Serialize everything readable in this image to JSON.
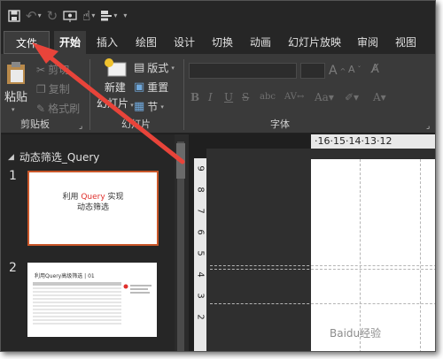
{
  "quick_access": {
    "items": [
      "save-icon",
      "undo-icon",
      "redo-icon",
      "slideshow-icon",
      "touch-mode-icon",
      "layout-icon",
      "customize-icon"
    ]
  },
  "tabs": {
    "file": "文件",
    "home": "开始",
    "insert": "插入",
    "draw": "绘图",
    "design": "设计",
    "transitions": "切换",
    "animations": "动画",
    "slideshow": "幻灯片放映",
    "review": "审阅",
    "view": "视图"
  },
  "ribbon": {
    "clipboard": {
      "paste": "粘贴",
      "cut": "剪切",
      "copy": "复制",
      "format_painter": "格式刷",
      "label": "剪贴板"
    },
    "slides": {
      "new_slide_line1": "新建",
      "new_slide_line2": "幻灯片",
      "layout": "版式",
      "reset": "重置",
      "section": "节",
      "label": "幻灯片"
    },
    "font": {
      "grow": "A",
      "shrink": "A",
      "bold": "B",
      "italic": "I",
      "underline": "U",
      "strikethrough": "S",
      "shadow": "abc",
      "label": "字体"
    }
  },
  "left_pane": {
    "section_title": "动态筛选_Query",
    "slides": [
      {
        "number": "1",
        "line1_before": "利用 ",
        "line1_highlight": "Query",
        "line1_after": " 实现",
        "line2": "动态筛选"
      },
      {
        "number": "2",
        "title": "利用Query高级筛选 | 01"
      }
    ]
  },
  "ruler": {
    "horizontal": "·16·15·14·13·12",
    "vertical": [
      "9",
      "8",
      "7",
      "6",
      "5",
      "4",
      "3",
      "2"
    ]
  },
  "watermark": "Baidu经验",
  "colors": {
    "accent": "#c9572a",
    "highlight": "#e0302c",
    "arrow": "#e8443a"
  }
}
